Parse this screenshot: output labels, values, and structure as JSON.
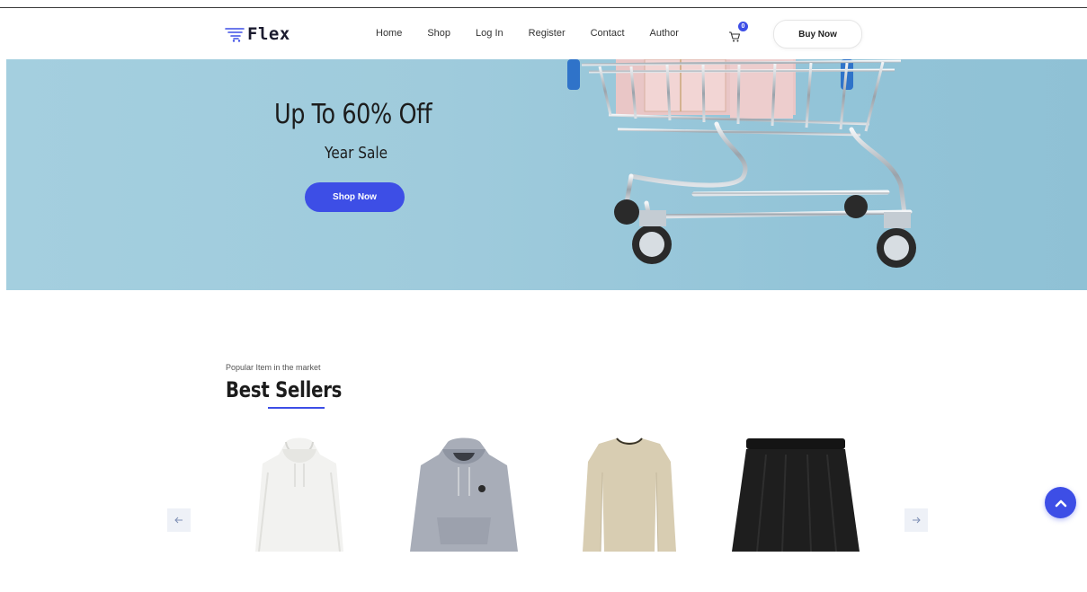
{
  "header": {
    "logo_text": "Flex",
    "nav": [
      "Home",
      "Shop",
      "Log In",
      "Register",
      "Contact",
      "Author"
    ],
    "cart_count": "0",
    "buy_now_label": "Buy Now"
  },
  "hero": {
    "title": "Up To 60% Off",
    "subtitle": "Year Sale",
    "cta_label": "Shop Now"
  },
  "best_sellers": {
    "eyebrow": "Popular Item in the market",
    "title": "Best Sellers",
    "products": [
      {
        "icon": "white-hoodie-image"
      },
      {
        "icon": "grey-hoodie-image"
      },
      {
        "icon": "beige-sweater-image"
      },
      {
        "icon": "black-skirt-image"
      }
    ]
  },
  "colors": {
    "accent": "#3d4ee6",
    "hero_bg": "#9fcbdc"
  },
  "icons": {
    "logo": "cart-logo-icon",
    "cart": "cart-icon",
    "prev": "arrow-left-icon",
    "next": "arrow-right-icon",
    "scroll_top": "chevron-up-icon"
  }
}
